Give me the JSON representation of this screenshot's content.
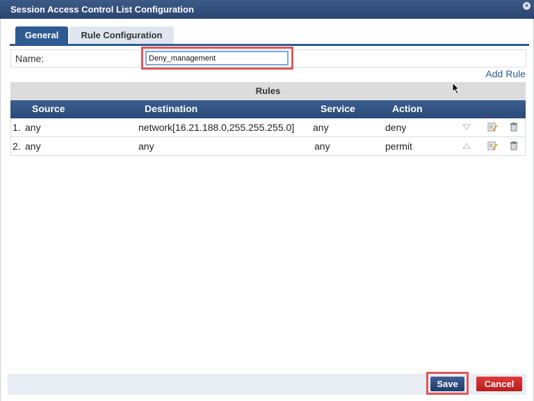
{
  "window": {
    "title": "Session Access Control List Configuration"
  },
  "tabs": [
    {
      "label": "General",
      "active": true
    },
    {
      "label": "Rule Configuration",
      "active": false
    }
  ],
  "name_field": {
    "label": "Name:",
    "value": "Deny_management"
  },
  "add_rule_label": "Add Rule",
  "rules": {
    "caption": "Rules",
    "columns": [
      "Source",
      "Destination",
      "Service",
      "Action"
    ],
    "rows": [
      {
        "index": "1.",
        "source": "any",
        "destination": "network[16.21.188.0,255.255.255.0]",
        "service": "any",
        "action": "deny"
      },
      {
        "index": "2.",
        "source": "any",
        "destination": "any",
        "service": "any",
        "action": "permit"
      }
    ]
  },
  "buttons": {
    "save": "Save",
    "cancel": "Cancel"
  },
  "colors": {
    "header_blue": "#2f5b93",
    "highlight_red": "#e05656",
    "cancel_red": "#c92a2a"
  },
  "icons": {
    "close": "close-icon",
    "move_down": "move-down-icon",
    "move_up": "move-up-icon",
    "edit": "edit-icon",
    "delete": "trash-icon"
  }
}
